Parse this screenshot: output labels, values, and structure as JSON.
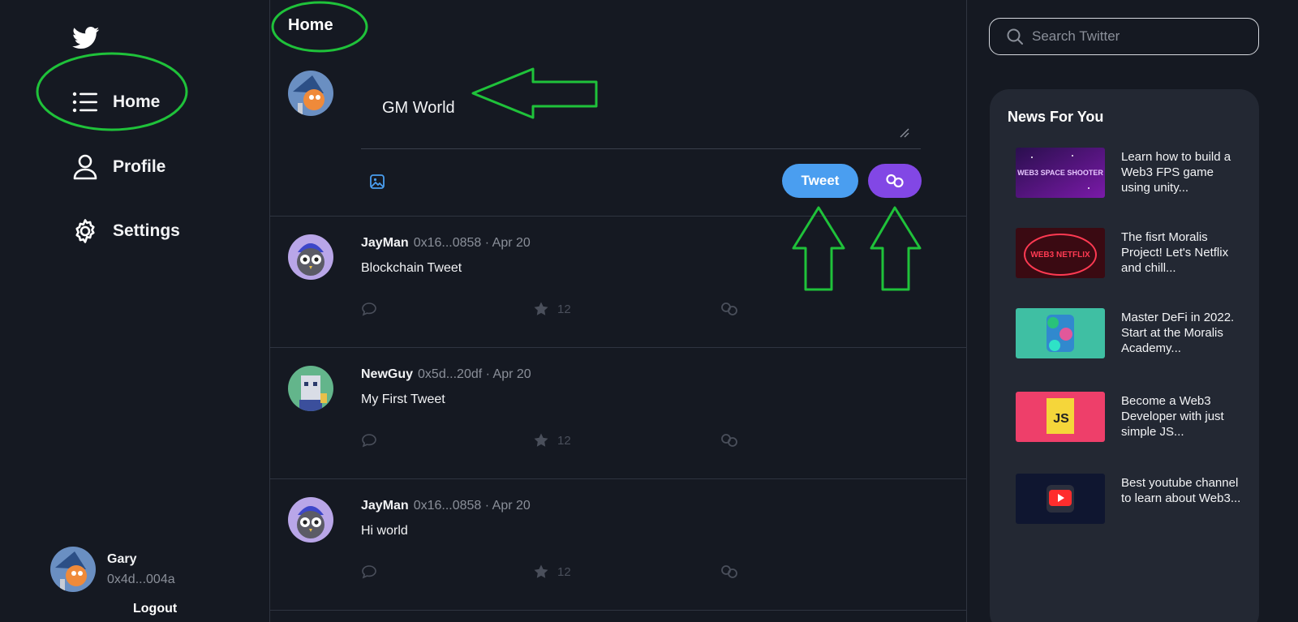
{
  "sidebar": {
    "logo_icon": "twitter-bird-icon",
    "items": [
      {
        "label": "Home",
        "icon": "list-icon"
      },
      {
        "label": "Profile",
        "icon": "user-icon"
      },
      {
        "label": "Settings",
        "icon": "gear-icon"
      }
    ],
    "user": {
      "name": "Gary",
      "address": "0x4d...004a"
    },
    "logout_label": "Logout"
  },
  "main": {
    "title": "Home",
    "composer": {
      "value": "GM World",
      "tweet_label": "Tweet",
      "polygon_icon": "polygon-link-icon",
      "media_icon": "image-icon"
    },
    "tweets": [
      {
        "author": "JayMan",
        "meta": "0x16...0858 · Apr 20",
        "text": "Blockchain Tweet",
        "stars": "12"
      },
      {
        "author": "NewGuy",
        "meta": "0x5d...20df · Apr 20",
        "text": "My First Tweet",
        "stars": "12"
      },
      {
        "author": "JayMan",
        "meta": "0x16...0858 · Apr 20",
        "text": "Hi world",
        "stars": "12"
      }
    ]
  },
  "right": {
    "search_placeholder": "Search Twitter",
    "news_title": "News For You",
    "news": [
      {
        "thumb_text": "WEB3 SPACE SHOOTER",
        "text": "Learn how to build a Web3 FPS game using unity..."
      },
      {
        "thumb_text": "WEB3 NETFLIX",
        "text": "The fisrt Moralis Project! Let's Netflix and chill..."
      },
      {
        "thumb_text": "",
        "text": "Master DeFi in 2022. Start at the Moralis Academy..."
      },
      {
        "thumb_text": "JS",
        "text": "Become a Web3 Developer with just simple JS..."
      },
      {
        "thumb_text": "",
        "text": "Best youtube channel to learn about Web3..."
      }
    ]
  },
  "colors": {
    "background": "#151922",
    "accent_blue": "#4a9ef0",
    "polygon_purple": "#8247e5",
    "annotation_green": "#1fc23a",
    "panel": "#232833"
  }
}
